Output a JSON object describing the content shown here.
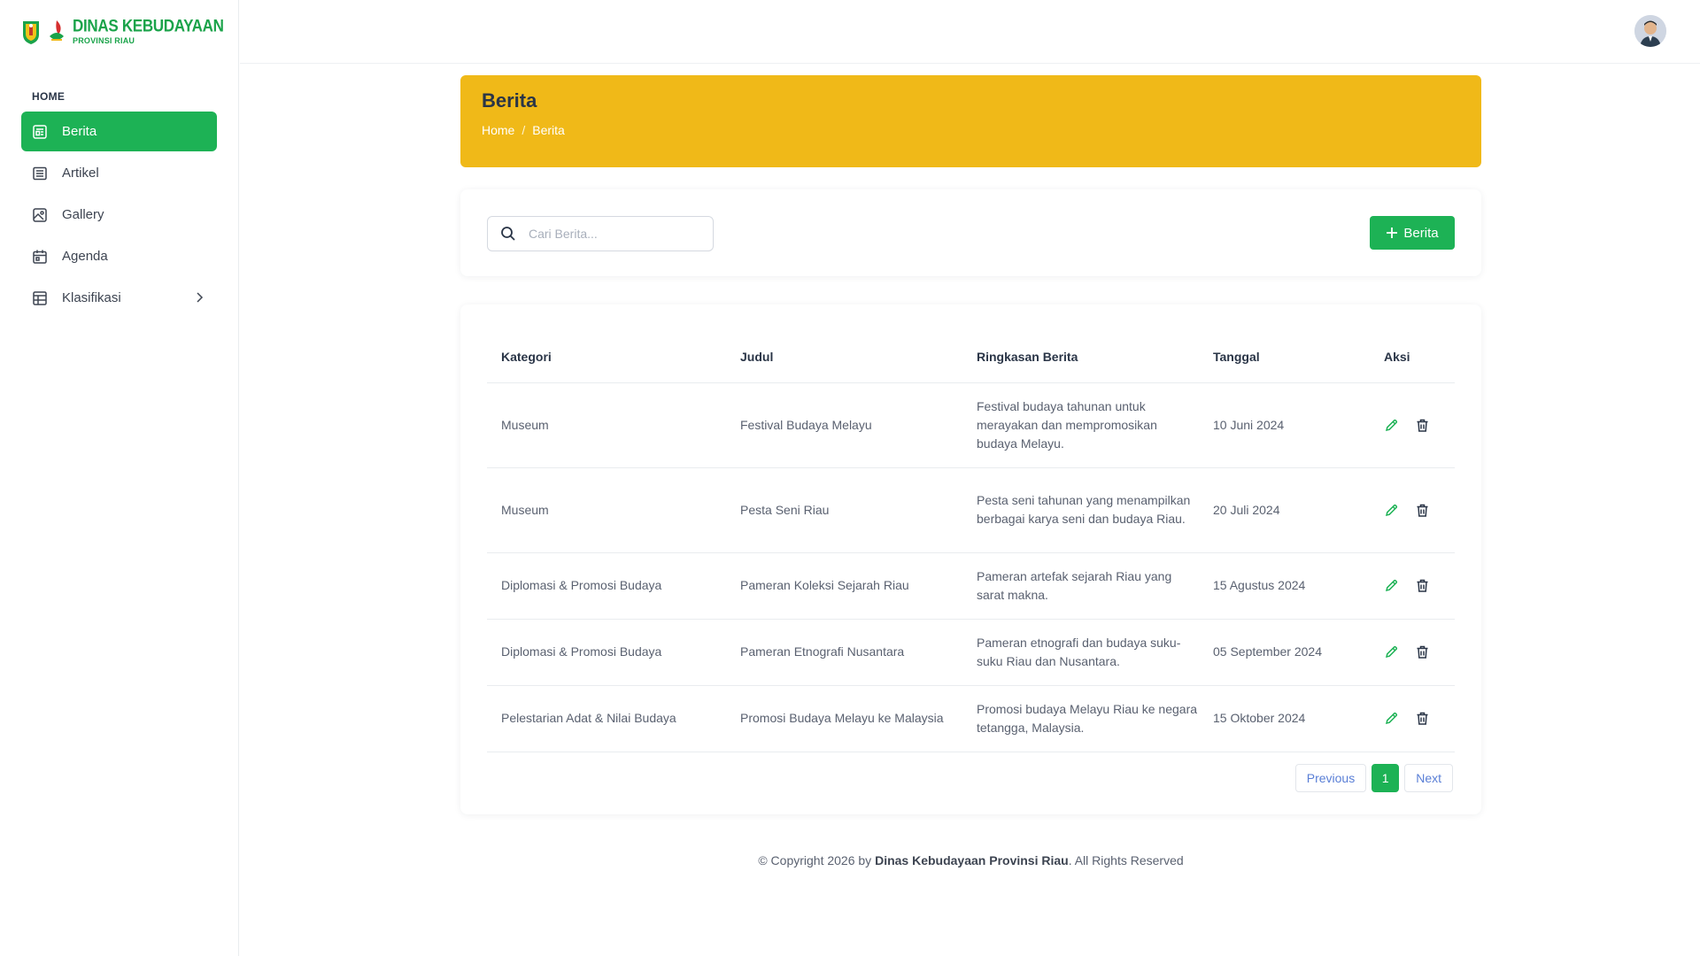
{
  "brand": {
    "title": "DINAS KEBUDAYAAN",
    "subtitle": "PROVINSI RIAU",
    "color": "#1aa34a"
  },
  "sidebar": {
    "section": "HOME",
    "items": [
      {
        "label": "Berita",
        "icon": "news-icon",
        "active": true
      },
      {
        "label": "Artikel",
        "icon": "article-icon",
        "active": false
      },
      {
        "label": "Gallery",
        "icon": "image-icon",
        "active": false
      },
      {
        "label": "Agenda",
        "icon": "calendar-icon",
        "active": false
      },
      {
        "label": "Klasifikasi",
        "icon": "table-icon",
        "active": false,
        "has_submenu": true
      }
    ]
  },
  "header": {
    "avatar_icon": "user-avatar"
  },
  "hero": {
    "title": "Berita",
    "breadcrumb": [
      "Home",
      "Berita"
    ],
    "color": "#f0b918"
  },
  "search": {
    "placeholder": "Cari Berita...",
    "value": ""
  },
  "add_button": {
    "label": "Berita",
    "icon": "plus-icon",
    "color": "#1db255"
  },
  "table": {
    "columns": [
      "Kategori",
      "Judul",
      "Ringkasan Berita",
      "Tanggal",
      "Aksi"
    ],
    "rows": [
      {
        "kategori": "Museum",
        "judul": "Festival Budaya Melayu",
        "ringkasan": "Festival budaya tahunan untuk merayakan dan mempromosikan budaya Melayu.",
        "tanggal": "10 Juni 2024"
      },
      {
        "kategori": "Museum",
        "judul": "Pesta Seni Riau",
        "ringkasan": "Pesta seni tahunan yang menampilkan berbagai karya seni dan budaya Riau.",
        "tanggal": "20 Juli 2024"
      },
      {
        "kategori": "Diplomasi & Promosi Budaya",
        "judul": "Pameran Koleksi Sejarah Riau",
        "ringkasan": "Pameran artefak sejarah Riau yang sarat makna.",
        "tanggal": "15 Agustus 2024"
      },
      {
        "kategori": "Diplomasi & Promosi Budaya",
        "judul": "Pameran Etnografi Nusantara",
        "ringkasan": "Pameran etnografi dan budaya suku-suku Riau dan Nusantara.",
        "tanggal": "05 September 2024"
      },
      {
        "kategori": "Pelestarian Adat & Nilai Budaya",
        "judul": "Promosi Budaya Melayu ke Malaysia",
        "ringkasan": "Promosi budaya Melayu Riau ke negara tetangga, Malaysia.",
        "tanggal": "15 Oktober 2024"
      }
    ],
    "edit_icon": "pencil-icon",
    "delete_icon": "trash-icon"
  },
  "pagination": {
    "previous": "Previous",
    "current": "1",
    "next": "Next"
  },
  "footer": {
    "prefix": "© Copyright 2026 by ",
    "org": "Dinas Kebudayaan Provinsi Riau",
    "suffix": ". All Rights Reserved"
  }
}
